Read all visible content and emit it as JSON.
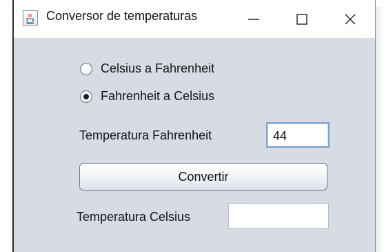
{
  "window": {
    "title": "Conversor de temperaturas",
    "icon": "java-cup-icon",
    "controls": {
      "minimize": "minimize-icon",
      "maximize": "maximize-icon",
      "close": "close-icon"
    }
  },
  "conversion": {
    "options": [
      {
        "label": "Celsius a Fahrenheit",
        "selected": false
      },
      {
        "label": "Fahrenheit a Celsius",
        "selected": true
      }
    ]
  },
  "input": {
    "label": "Temperatura Fahrenheit",
    "value": "44"
  },
  "action": {
    "label": "Convertir"
  },
  "output": {
    "label": "Temperatura Celsius",
    "value": ""
  },
  "colors": {
    "window_background": "#d7dbe3",
    "titlebar_background": "#ffffff",
    "focus_border": "#7ea2c8"
  }
}
